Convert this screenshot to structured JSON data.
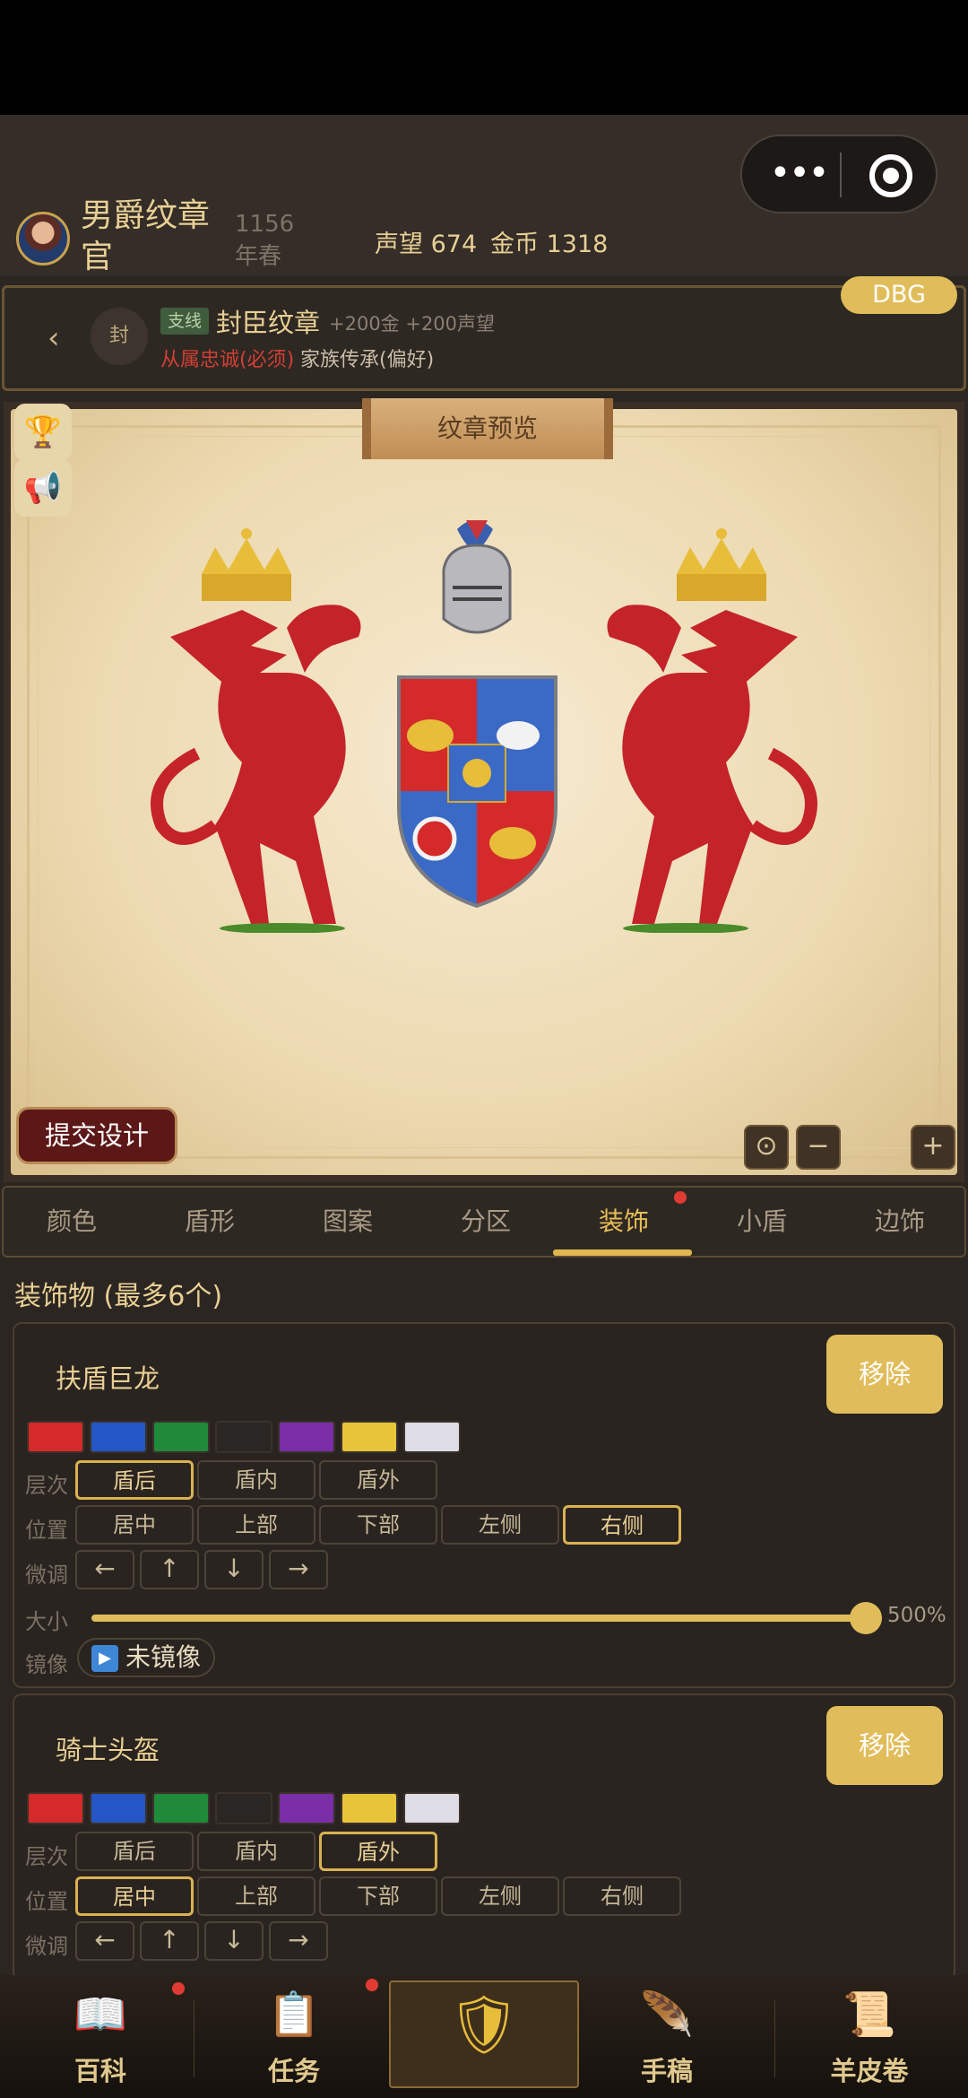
{
  "header": {
    "capsule_more": "•••",
    "rank": "男爵纹章官",
    "year": "1156年春",
    "reputation": "声望 674",
    "gold": "金币 1318",
    "debug": "DBG"
  },
  "quest": {
    "back": "‹",
    "seal": "封",
    "tag": "支线",
    "title": "封臣纹章",
    "reward": "+200金 +200声望",
    "requirement": "从属忠诚(必须)",
    "preference": "家族传承(偏好)"
  },
  "preview": {
    "title": "纹章预览",
    "submit": "提交设计",
    "zoom_out": "−",
    "zoom_in": "+"
  },
  "tabs": [
    "颜色",
    "盾形",
    "图案",
    "分区",
    "装饰",
    "小盾",
    "边饰"
  ],
  "active_tab": "装饰",
  "section_title": "装饰物 (最多6个)",
  "labels": {
    "layer": "层次",
    "position": "位置",
    "nudge": "微调",
    "size": "大小",
    "mirror": "镜像",
    "remove": "移除"
  },
  "layer_options": [
    "盾后",
    "盾内",
    "盾外"
  ],
  "position_options": [
    "居中",
    "上部",
    "下部",
    "左侧",
    "右侧"
  ],
  "nudge_arrows": [
    "←",
    "↑",
    "↓",
    "→"
  ],
  "palette": [
    "#d42a2a",
    "#2457c5",
    "#1f8a3a",
    "#2a2624",
    "#7a2ea8",
    "#e8c43a",
    "#dedde6"
  ],
  "decorations": [
    {
      "name": "扶盾巨龙",
      "layer": "盾后",
      "position": "右侧",
      "size_value": 500,
      "size_text": "500%",
      "mirror_text": "未镜像"
    },
    {
      "name": "骑士头盔",
      "layer": "盾外",
      "position": "居中"
    }
  ],
  "nav": [
    "百科",
    "任务",
    "",
    "手稿",
    "羊皮卷"
  ]
}
